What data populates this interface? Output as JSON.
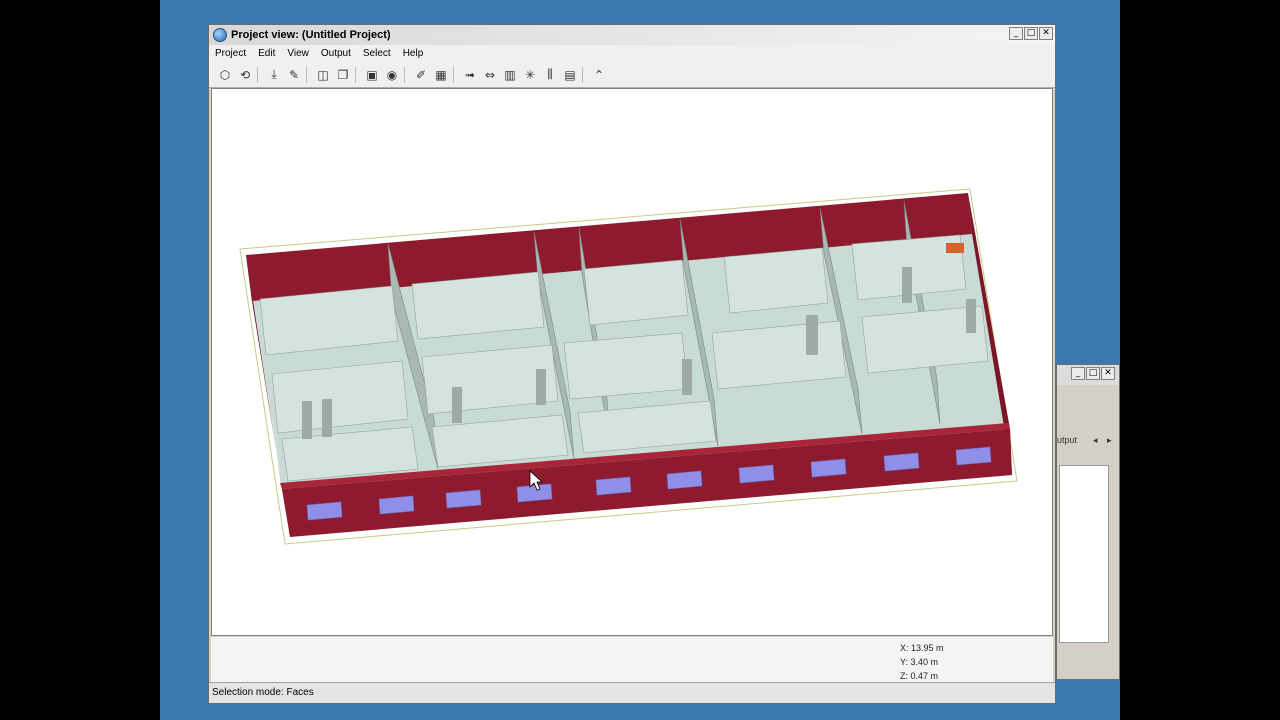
{
  "window": {
    "title": "Project view: (Untitled Project)",
    "controls": {
      "minimize": "_",
      "maximize": "□",
      "close": "✕"
    }
  },
  "menu": [
    "Project",
    "Edit",
    "View",
    "Output",
    "Select",
    "Help"
  ],
  "toolbar": {
    "icons": [
      "new-project-icon",
      "open-project-icon",
      "import-icon",
      "paint-icon",
      "cube-icon",
      "copy-icon",
      "render-icon",
      "materials-icon",
      "edit-icon",
      "grid-icon",
      "arrow-right-icon",
      "split-icon",
      "chart-icon",
      "sun-icon",
      "bars-icon",
      "layers-icon",
      "more-icon"
    ]
  },
  "coords": {
    "x": "X: 13.95 m",
    "y": "Y: 3.40 m",
    "z": "Z: 0.47 m"
  },
  "status": "Selection mode: Faces",
  "secondary_window": {
    "tab_label": "utput",
    "controls": {
      "minimize": "_",
      "maximize": "□",
      "close": "✕"
    }
  },
  "colors": {
    "wall": "#8e1b2d",
    "floor": "#c9dcd6",
    "window_glass": "#8f8fe8",
    "desktop": "#3b78b2",
    "accent_window": "#d9622b"
  }
}
